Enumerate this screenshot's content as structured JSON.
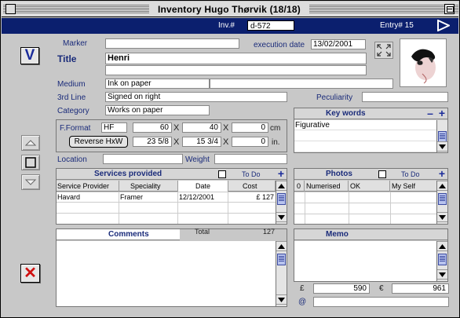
{
  "window": {
    "title": "Inventory Hugo Thørvik (18/18)"
  },
  "navbar": {
    "inv_label": "Inv.#",
    "inv_value": "d-572",
    "entry_label": "Entry# 15"
  },
  "record": {
    "marker_label": "Marker",
    "marker_value": "",
    "execution_date_label": "execution date",
    "execution_date_value": "13/02/2001",
    "title_label": "Title",
    "title_value": "Henri",
    "title_line2": "",
    "medium_label": "Medium",
    "medium_value": "Ink on paper",
    "medium_value2": "",
    "third_line_label": "3rd Line",
    "third_line_value": "Signed on right",
    "peculiarity_label": "Peculiarity",
    "peculiarity_value": "",
    "category_label": "Category",
    "category_value": "Works on paper",
    "location_label": "Location",
    "location_value": "",
    "weight_label": "Weight",
    "weight_value": ""
  },
  "format": {
    "label": "F.Format",
    "format_value": "HF",
    "reverse_button": "Reverse HxW",
    "cm": {
      "h": "60",
      "w": "40",
      "d": "0",
      "unit": "cm"
    },
    "in": {
      "h": "23 5/8",
      "w": "15 3/4",
      "d": "0",
      "unit": "in."
    },
    "times": "X"
  },
  "keywords": {
    "title": "Key words",
    "items": [
      "Figurative"
    ]
  },
  "services": {
    "title": "Services provided",
    "todo_label": "To Do",
    "columns": [
      "Service Provider",
      "Speciality",
      "Date",
      "Cost"
    ],
    "rows": [
      {
        "provider": "Havard",
        "speciality": "Framer",
        "date": "12/12/2001",
        "cost": "£ 127"
      }
    ]
  },
  "photos": {
    "title": "Photos",
    "todo_label": "To Do",
    "columns": [
      "0",
      "Numerised",
      "OK",
      "My Self"
    ]
  },
  "comments": {
    "title": "Comments",
    "total_label": "Total",
    "total_value": "127",
    "text": ""
  },
  "memo": {
    "title": "Memo",
    "text": ""
  },
  "prices": {
    "pound_symbol": "£",
    "pound_value": "590",
    "euro_symbol": "€",
    "euro_value": "961",
    "at_symbol": "@",
    "at_value": ""
  },
  "buttons": {
    "validate": "V",
    "delete": "✕"
  },
  "colors": {
    "navbar": "#0b1f6e",
    "window_bg": "#c8c8c8",
    "accent_blue": "#1a2b9a",
    "delete_red": "#d01010"
  },
  "icons": [
    "close-box-icon",
    "zoom-box-icon",
    "next-arrow-icon",
    "validate-icon",
    "up-arrow-icon",
    "stop-square-icon",
    "down-arrow-icon",
    "delete-x-icon",
    "expand-icon",
    "artwork-thumbnail"
  ]
}
